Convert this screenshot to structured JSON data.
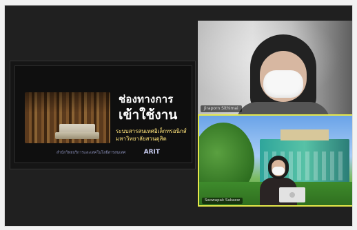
{
  "slide": {
    "title_line1": "ช่องทางการ",
    "title_line2": "เข้าใช้งาน",
    "subtitle_line1": "ระบบสารสนเทศอิเล็กทรอนิกส์",
    "subtitle_line2": "มหาวิทยาลัยสวนดุสิต",
    "footer_text": "สำนักวิทยบริการและเทคโนโลยีสารสนเทศ",
    "footer_logo": "ARIT"
  },
  "participants": [
    {
      "name": "Jiraporn Sithimai"
    },
    {
      "name": "Saowapak Sakaew"
    }
  ],
  "colors": {
    "active_speaker_border": "#e6e84a",
    "slide_subtitle": "#ffe37a"
  }
}
